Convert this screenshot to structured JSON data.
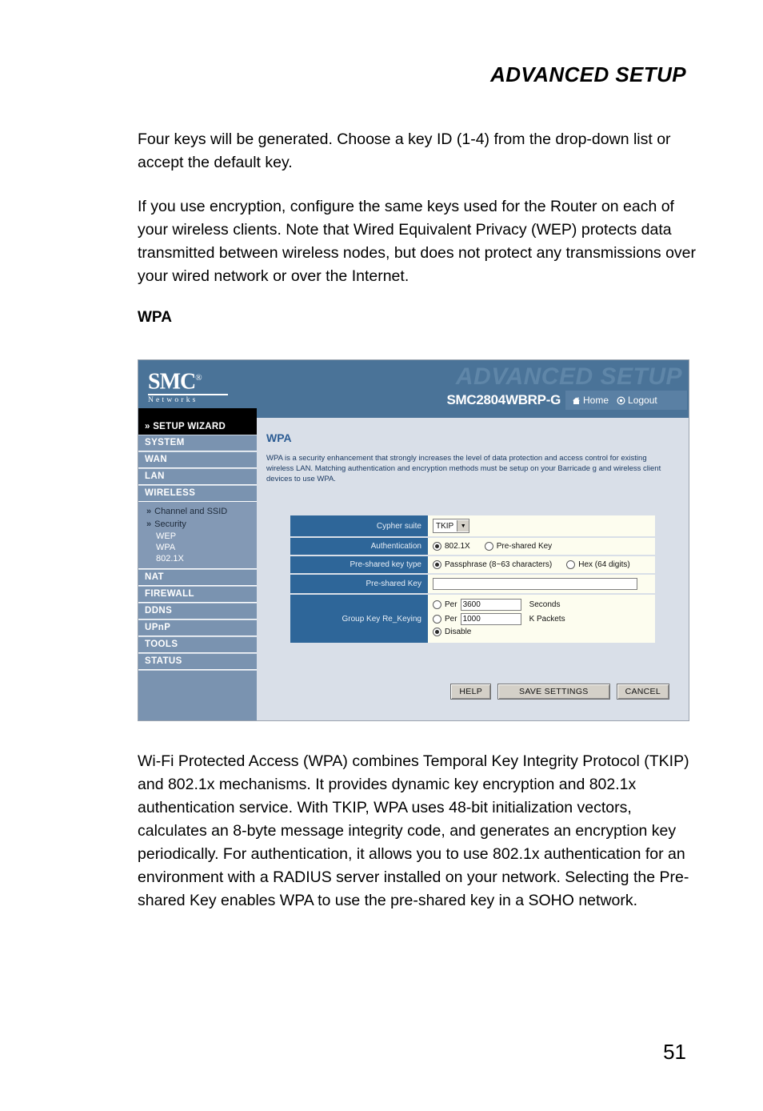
{
  "page": {
    "running_head": "ADVANCED SETUP",
    "number": "51"
  },
  "body": {
    "para1": "Four keys will be generated. Choose a key ID (1-4) from the drop-down list or accept the default key.",
    "para2": "If you use encryption, configure the same keys used for the Router on each of your wireless clients. Note that Wired Equivalent Privacy (WEP) protects data transmitted between wireless nodes, but does not protect any transmissions over your wired network or over the Internet.",
    "subhead": "WPA",
    "para3": "Wi-Fi Protected Access (WPA) combines Temporal Key Integrity Protocol (TKIP) and 802.1x mechanisms. It provides dynamic key encryption and 802.1x authentication service. With TKIP, WPA uses 48-bit initialization vectors, calculates an 8-byte message integrity code, and generates an encryption key periodically. For authentication, it allows you to use 802.1x authentication for an environment with a RADIUS server installed on your network. Selecting the Pre-shared Key enables WPA to use the pre-shared key in a SOHO network."
  },
  "screenshot": {
    "banner": {
      "logo_brand": "SMC",
      "logo_reg": "®",
      "logo_sub": "Networks",
      "ghost_title": "ADVANCED SETUP",
      "model": "SMC2804WBRP-G",
      "home_label": "Home",
      "logout_label": "Logout"
    },
    "sidebar": {
      "wizard": "» SETUP WIZARD",
      "items": [
        {
          "label": "SYSTEM"
        },
        {
          "label": "WAN"
        },
        {
          "label": "LAN"
        },
        {
          "label": "WIRELESS"
        }
      ],
      "submenu": [
        {
          "label": "Channel and SSID",
          "chevron": "»"
        },
        {
          "label": "Security",
          "chevron": "»"
        }
      ],
      "submenu_leaves": [
        {
          "label": "WEP"
        },
        {
          "label": "WPA"
        },
        {
          "label": "802.1X"
        }
      ],
      "items_after": [
        {
          "label": "NAT"
        },
        {
          "label": "FIREWALL"
        },
        {
          "label": "DDNS"
        },
        {
          "label": "UPnP"
        },
        {
          "label": "TOOLS"
        },
        {
          "label": "STATUS"
        }
      ]
    },
    "pane": {
      "title": "WPA",
      "description": "WPA is a security enhancement that strongly increases the level of data protection and access control for existing wireless LAN. Matching authentication and encryption methods must be setup on your Barricade g and wireless client devices to use WPA.",
      "rows": {
        "cypher_suite": {
          "label": "Cypher suite",
          "value": "TKIP"
        },
        "authentication": {
          "label": "Authentication",
          "options": [
            {
              "label": "802.1X",
              "selected": true
            },
            {
              "label": "Pre-shared Key",
              "selected": false
            }
          ]
        },
        "preshared_key_type": {
          "label": "Pre-shared key type",
          "options": [
            {
              "label": "Passphrase (8~63 characters)",
              "selected": true
            },
            {
              "label": "Hex (64 digits)",
              "selected": false
            }
          ]
        },
        "preshared_key": {
          "label": "Pre-shared Key",
          "value": ""
        },
        "group_key_rekeying": {
          "label": "Group Key Re_Keying",
          "per_label": "Per",
          "seconds_value": "3600",
          "seconds_unit": "Seconds",
          "seconds_selected": false,
          "packets_value": "1000",
          "packets_unit": "K Packets",
          "packets_selected": false,
          "disable_label": "Disable",
          "disable_selected": true
        }
      },
      "buttons": {
        "help": "HELP",
        "save": "SAVE SETTINGS",
        "cancel": "CANCEL"
      }
    },
    "colors": {
      "banner_blue": "#4a7398",
      "label_blue": "#2e6699",
      "pane_bg": "#d9dfe8",
      "field_bg": "#fdfdef",
      "sidebar_blue": "#7a93b0",
      "submenu_blue": "#8399b5",
      "pane_title": "#2d5d94"
    }
  }
}
